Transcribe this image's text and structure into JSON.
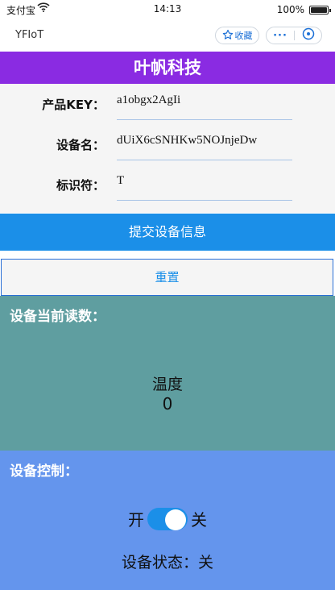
{
  "status_bar": {
    "carrier": "支付宝",
    "time": "14:13",
    "battery": "100%"
  },
  "nav": {
    "app_title": "YFIoT",
    "favorite_label": "收藏",
    "more_label": "···"
  },
  "brand": "叶帆科技",
  "form": {
    "fields": [
      {
        "label": "产品KEY：",
        "value": "a1obgx2AgIi"
      },
      {
        "label": "设备名：",
        "value": "dUiX6cSNHKw5NOJnjeDw"
      },
      {
        "label": "标识符：",
        "value": "T"
      }
    ],
    "submit_label": "提交设备信息",
    "reset_label": "重置"
  },
  "readings": {
    "title": "设备当前读数：",
    "metric_name": "温度",
    "metric_value": "0"
  },
  "control": {
    "title": "设备控制：",
    "on_label": "开",
    "off_label": "关",
    "switch_state": "off",
    "status_label": "设备状态：",
    "status_value": "关"
  },
  "colors": {
    "brand": "#8a2be2",
    "submit": "#1b8fe8",
    "readings_bg": "#5f9ea0",
    "control_bg": "#6495ed"
  }
}
